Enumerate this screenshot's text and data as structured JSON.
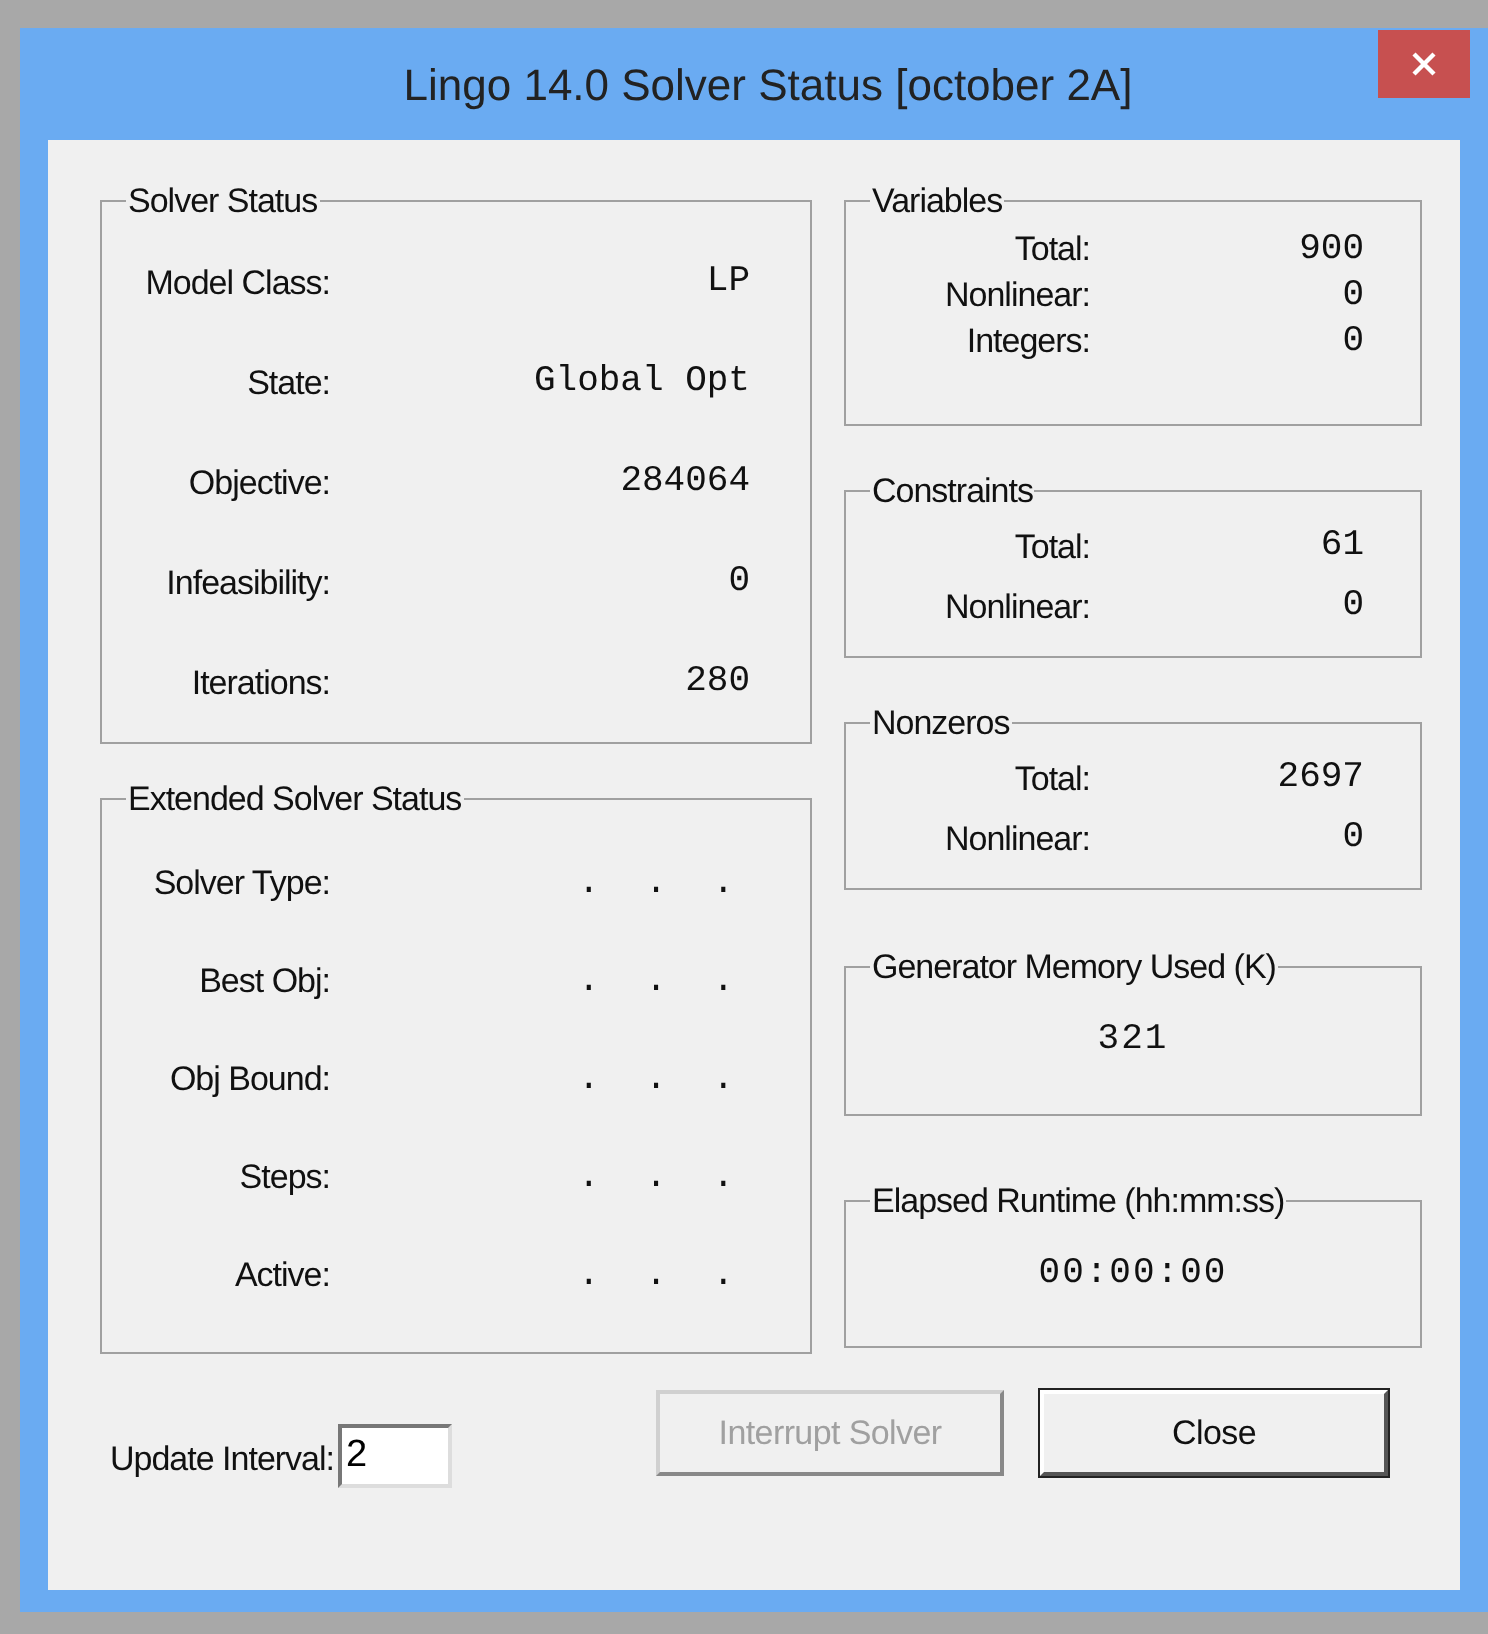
{
  "window": {
    "title": "Lingo 14.0 Solver Status [october 2A]"
  },
  "solver_status": {
    "title": "Solver Status",
    "rows": [
      {
        "label": "Model Class:",
        "value": "LP"
      },
      {
        "label": "State:",
        "value": "Global Opt"
      },
      {
        "label": "Objective:",
        "value": "284064"
      },
      {
        "label": "Infeasibility:",
        "value": "0"
      },
      {
        "label": "Iterations:",
        "value": "280"
      }
    ]
  },
  "extended_solver_status": {
    "title": "Extended Solver Status",
    "rows": [
      {
        "label": "Solver Type:",
        "value": ". . ."
      },
      {
        "label": "Best Obj:",
        "value": ". . ."
      },
      {
        "label": "Obj Bound:",
        "value": ". . ."
      },
      {
        "label": "Steps:",
        "value": ". . ."
      },
      {
        "label": "Active:",
        "value": ". . ."
      }
    ]
  },
  "variables": {
    "title": "Variables",
    "rows": [
      {
        "label": "Total:",
        "value": "900"
      },
      {
        "label": "Nonlinear:",
        "value": "0"
      },
      {
        "label": "Integers:",
        "value": "0"
      }
    ]
  },
  "constraints": {
    "title": "Constraints",
    "rows": [
      {
        "label": "Total:",
        "value": "61"
      },
      {
        "label": "Nonlinear:",
        "value": "0"
      }
    ]
  },
  "nonzeros": {
    "title": "Nonzeros",
    "rows": [
      {
        "label": "Total:",
        "value": "2697"
      },
      {
        "label": "Nonlinear:",
        "value": "0"
      }
    ]
  },
  "generator_memory": {
    "title": "Generator Memory Used (K)",
    "value": "321"
  },
  "elapsed_runtime": {
    "title": "Elapsed Runtime (hh:mm:ss)",
    "value": "00:00:00"
  },
  "update_interval": {
    "label": "Update Interval:",
    "value": "2"
  },
  "buttons": [
    {
      "label": "Interrupt Solver",
      "disabled": true
    },
    {
      "label": "Close",
      "disabled": false
    }
  ]
}
